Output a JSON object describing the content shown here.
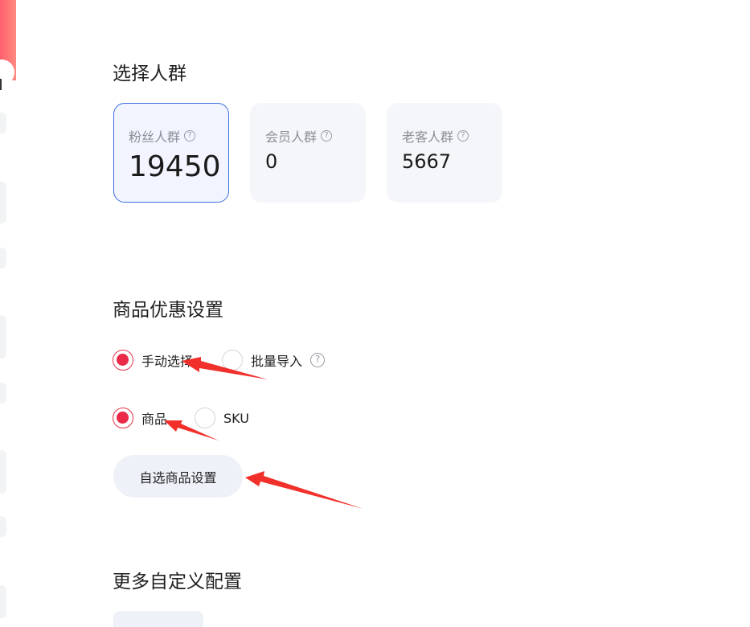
{
  "crowd": {
    "title": "选择人群",
    "cards": [
      {
        "name": "粉丝人群",
        "count": "19450",
        "selected": true
      },
      {
        "name": "会员人群",
        "count": "0",
        "selected": false
      },
      {
        "name": "老客人群",
        "count": "5667",
        "selected": false
      }
    ]
  },
  "discount": {
    "title": "商品优惠设置",
    "mode_options": [
      {
        "label": "手动选择",
        "checked": true
      },
      {
        "label": "批量导入",
        "checked": false
      }
    ],
    "type_options": [
      {
        "label": "商品",
        "checked": true
      },
      {
        "label": "SKU",
        "checked": false
      }
    ],
    "custom_button": "自选商品设置"
  },
  "more": {
    "title": "更多自定义配置"
  },
  "icons": {
    "help": "question-circle-icon"
  },
  "colors": {
    "accent_red": "#ea2a48",
    "selected_blue": "#3b6fe0",
    "arrow_red": "#f2302b"
  }
}
